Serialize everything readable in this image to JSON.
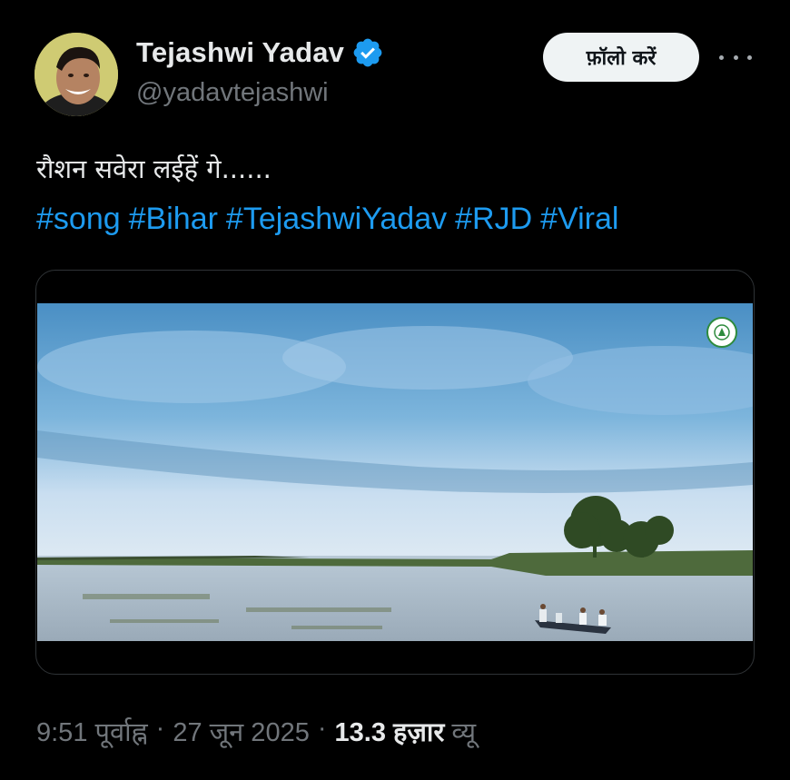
{
  "author": {
    "display_name": "Tejashwi Yadav",
    "handle": "@yadavtejashwi",
    "verified": true
  },
  "actions": {
    "follow_label": "फ़ॉलो करें",
    "more_icon": "more-horizontal-icon"
  },
  "tweet": {
    "text": "रौशन सवेरा लईहें गे......",
    "hashtags": [
      "#song",
      "#Bihar",
      "#TejashwiYadav",
      "#RJD",
      "#Viral"
    ]
  },
  "media": {
    "type": "video",
    "logo_icon": "rjd-logo-icon"
  },
  "meta": {
    "time": "9:51 पूर्वाह्न",
    "separator": "·",
    "date": "27 जून 2025",
    "views_count": "13.3",
    "views_unit": "हज़ार",
    "views_label": "व्यू"
  },
  "colors": {
    "background": "#000000",
    "text_primary": "#e7e9ea",
    "text_secondary": "#71767b",
    "link": "#1d9bf0",
    "verified": "#1d9bf0",
    "button_bg": "#eff3f4"
  }
}
